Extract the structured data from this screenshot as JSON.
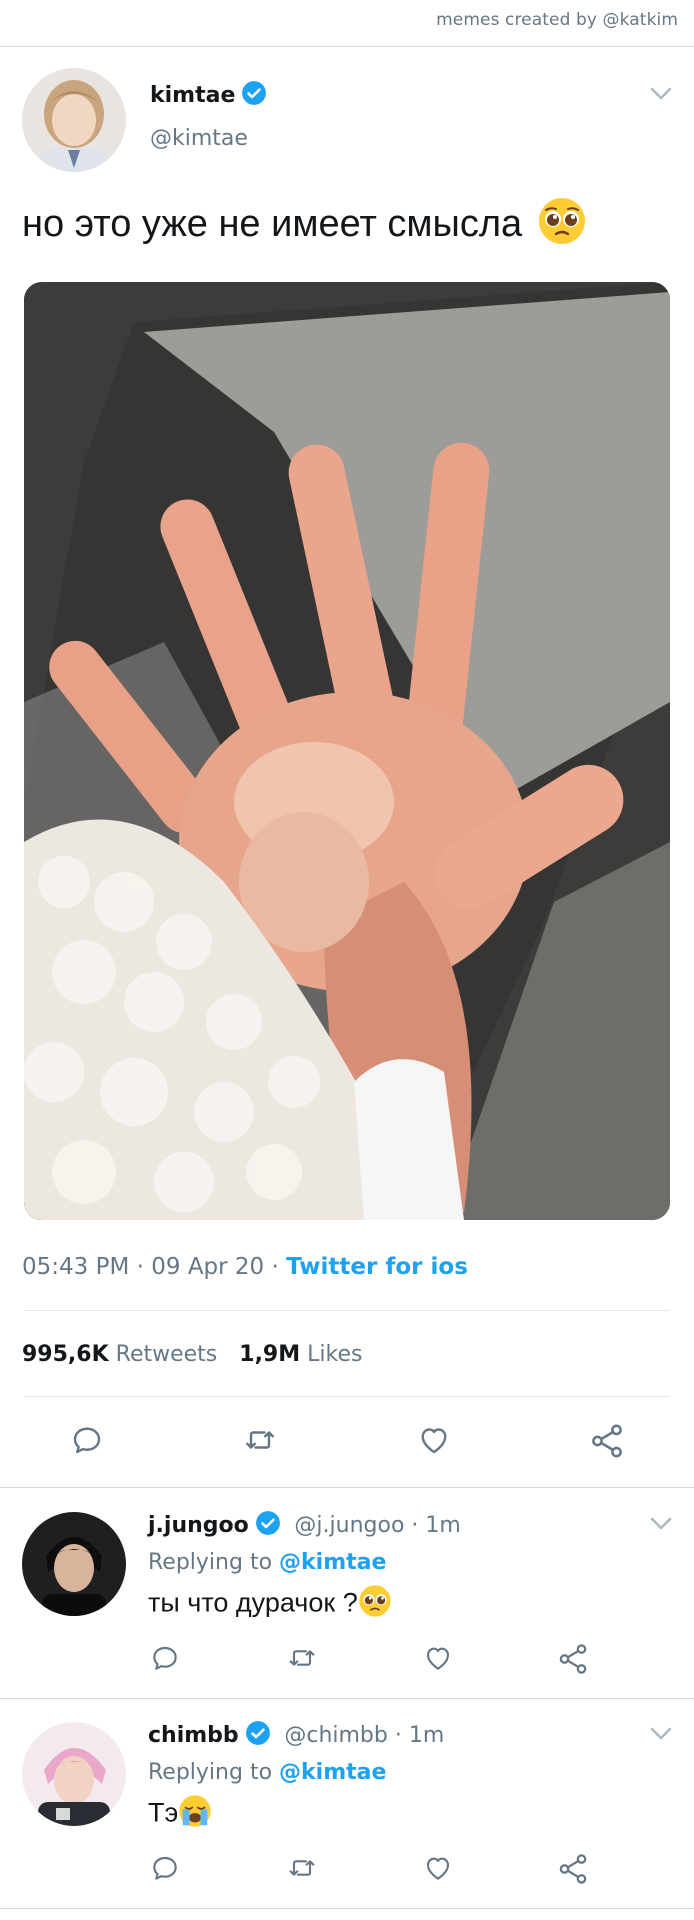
{
  "credit": "memes created by @katkim",
  "tweet": {
    "name": "kimtae",
    "handle": "@kimtae",
    "text": "но это уже не имеет смысла",
    "time": "05:43 PM",
    "date": "09 Apr 20",
    "source": "Twitter for ios",
    "retweets_count": "995,6K",
    "retweets_label": "Retweets",
    "likes_count": "1,9M",
    "likes_label": "Likes"
  },
  "replies": [
    {
      "name": "j.jungoo",
      "handle": "@j.jungoo",
      "time": "1m",
      "replying_label": "Replying to",
      "mention": "@kimtae",
      "text": "ты что дурачок ?"
    },
    {
      "name": "chimbb",
      "handle": "@chimbb",
      "time": "1m",
      "replying_label": "Replying to",
      "mention": "@kimtae",
      "text": "Тэ"
    }
  ],
  "icons": [
    "verified-badge-icon",
    "chevron-down-icon",
    "reply-icon",
    "retweet-icon",
    "like-icon",
    "share-icon",
    "pleading-face-emoji",
    "crying-face-emoji"
  ],
  "colors": {
    "accent": "#1da1f2",
    "secondary_text": "#657786",
    "divider": "#e1e8ed"
  }
}
